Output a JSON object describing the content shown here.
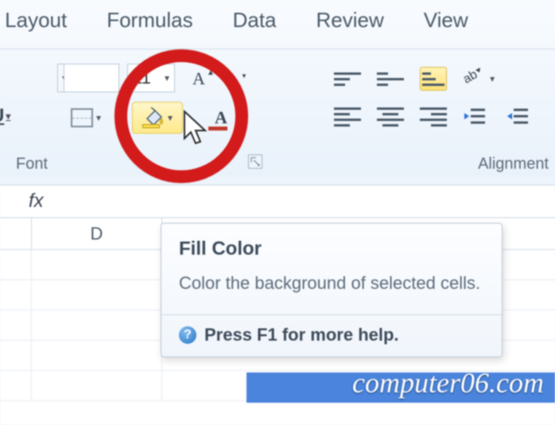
{
  "tabs": {
    "page_layout": "ge Layout",
    "formulas": "Formulas",
    "data": "Data",
    "review": "Review",
    "view": "View"
  },
  "font_group": {
    "label": "Font",
    "size_value": "11",
    "underline_label": "U"
  },
  "align_group": {
    "label": "Alignment",
    "orientation_label": "ab"
  },
  "formula_bar": {
    "fx": "fx"
  },
  "grid": {
    "col_D": "D"
  },
  "tooltip": {
    "title": "Fill Color",
    "desc": "Color the background of selected cells.",
    "help": "Press F1 for more help."
  },
  "watermark": "computer06.com",
  "icons": {
    "caret": "▾",
    "help_q": "?"
  }
}
